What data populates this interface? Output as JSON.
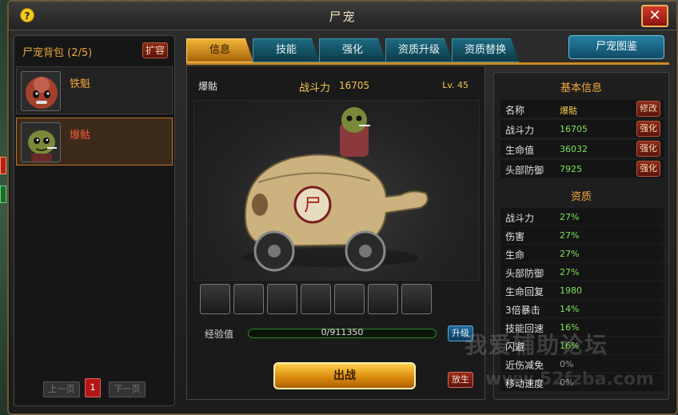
{
  "window": {
    "title": "尸宠"
  },
  "bag": {
    "header": "尸宠背包 (2/5)",
    "expand_label": "扩容",
    "pets": [
      {
        "name": "铁魁",
        "color": "#f0a23a"
      },
      {
        "name": "爆骷",
        "color": "#f05a3a"
      }
    ],
    "pager": {
      "prev_label": "上一页",
      "page": "1",
      "next_label": "下一页"
    }
  },
  "tabs": [
    {
      "label": "信息",
      "active": true
    },
    {
      "label": "技能",
      "active": false
    },
    {
      "label": "强化",
      "active": false
    },
    {
      "label": "资质升级",
      "active": false
    },
    {
      "label": "资质替换",
      "active": false
    }
  ],
  "codex_label": "尸宠图鉴",
  "detail": {
    "name": "爆骷",
    "power_label": "战斗力",
    "power_value": "16705",
    "level": "Lv. 45",
    "skills": [
      "skill-icon-1",
      "skill-icon-2",
      "skill-icon-3",
      "skill-icon-4",
      "skill-icon-5",
      "skill-icon-6",
      "skill-icon-7"
    ],
    "exp_label": "经验值",
    "exp_text": "0/911350",
    "exp_fraction": 0.0,
    "upgrade_label": "升级",
    "battle_label": "出战",
    "release_label": "放生"
  },
  "basic_info": {
    "title": "基本信息",
    "rows": [
      {
        "label": "名称",
        "value": "爆骷",
        "button": "修改"
      },
      {
        "label": "战斗力",
        "value": "16705",
        "button": "强化"
      },
      {
        "label": "生命值",
        "value": "36032",
        "button": "强化"
      },
      {
        "label": "头部防御",
        "value": "7925",
        "button": "强化"
      }
    ]
  },
  "aptitude": {
    "title": "资质",
    "rows": [
      {
        "label": "战斗力",
        "value": "27%"
      },
      {
        "label": "伤害",
        "value": "27%"
      },
      {
        "label": "生命",
        "value": "27%"
      },
      {
        "label": "头部防御",
        "value": "27%"
      },
      {
        "label": "生命回复",
        "value": "1980"
      },
      {
        "label": "3倍暴击",
        "value": "14%"
      },
      {
        "label": "技能回速",
        "value": "16%"
      },
      {
        "label": "闪避",
        "value": "16%"
      },
      {
        "label": "近伤减免",
        "value": "0%"
      },
      {
        "label": "移动速度",
        "value": "0%"
      }
    ]
  },
  "watermark": {
    "line1": "我爱辅助论坛",
    "line2": "www.52fzba.com"
  }
}
